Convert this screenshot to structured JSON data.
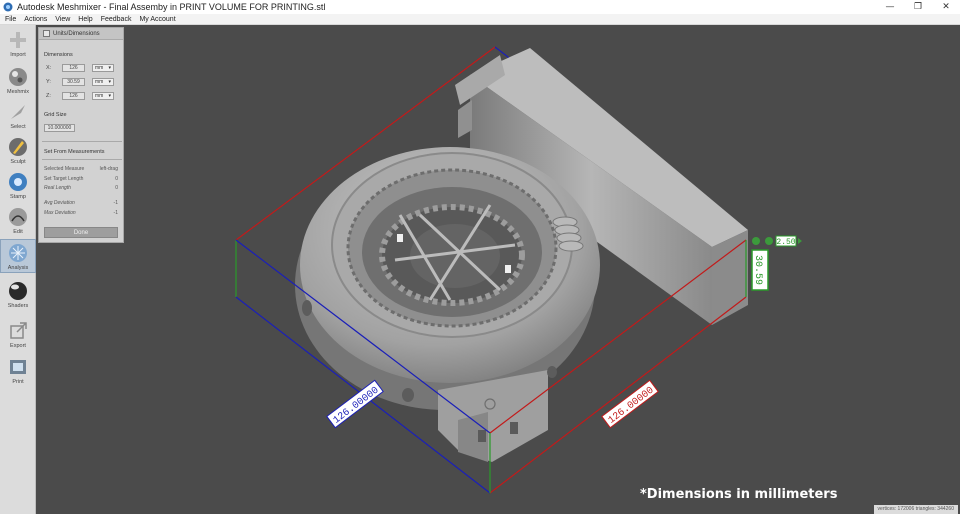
{
  "window": {
    "title": "Autodesk Meshmixer - Final Assemby in PRINT VOLUME FOR PRINTING.stl",
    "minimize_glyph": "—",
    "maximize_glyph": "❐",
    "close_glyph": "✕"
  },
  "menu": [
    "File",
    "Actions",
    "View",
    "Help",
    "Feedback",
    "My Account"
  ],
  "toolbar": [
    {
      "label": "Import",
      "icon": "import-plus-icon"
    },
    {
      "label": "Meshmix",
      "icon": "meshmix-sphere-icon"
    },
    {
      "label": "Select",
      "icon": "select-arrow-icon"
    },
    {
      "label": "Sculpt",
      "icon": "sculpt-brush-icon"
    },
    {
      "label": "Stamp",
      "icon": "stamp-icon"
    },
    {
      "label": "Edit",
      "icon": "edit-icon"
    },
    {
      "label": "Analysis",
      "icon": "analysis-icon",
      "active": true
    },
    {
      "label": "Shaders",
      "icon": "shaders-sphere-icon"
    },
    {
      "label": "Export",
      "icon": "export-icon"
    },
    {
      "label": "Print",
      "icon": "print-icon"
    }
  ],
  "panel": {
    "title": "Units/Dimensions",
    "dimensions_label": "Dimensions",
    "dims": [
      {
        "axis": "X:",
        "value": "126",
        "unit": "mm"
      },
      {
        "axis": "Y:",
        "value": "30.59",
        "unit": "mm"
      },
      {
        "axis": "Z:",
        "value": "126",
        "unit": "mm"
      }
    ],
    "grid_label": "Grid Size",
    "grid_value": "10.000000",
    "measure_section": "Set From Measurements",
    "measure_rows": [
      {
        "label": "Selected Measure",
        "value": "left-drag"
      },
      {
        "label": "Set Target Length",
        "value": "0"
      },
      {
        "label": "Real Length",
        "value": "0"
      },
      {
        "label": "Avg Deviation",
        "value": "-1"
      },
      {
        "label": "Max Deviation",
        "value": "-1"
      }
    ],
    "done_label": "Done"
  },
  "viewport": {
    "dim_x_label": "126.00000",
    "dim_y_label": "126.00000",
    "dim_z_label": "30.59",
    "dim_z_handle": "2.50",
    "caption": "*Dimensions in millimeters",
    "status": "vertices: 172006 triangles: 344260"
  },
  "colors": {
    "bbox_red": "#c21a1a",
    "bbox_blue": "#1a1fb8",
    "bbox_green": "#2a9a2a",
    "model_gray": "#9c9c9c",
    "viewport_bg": "#4b4b4b"
  }
}
